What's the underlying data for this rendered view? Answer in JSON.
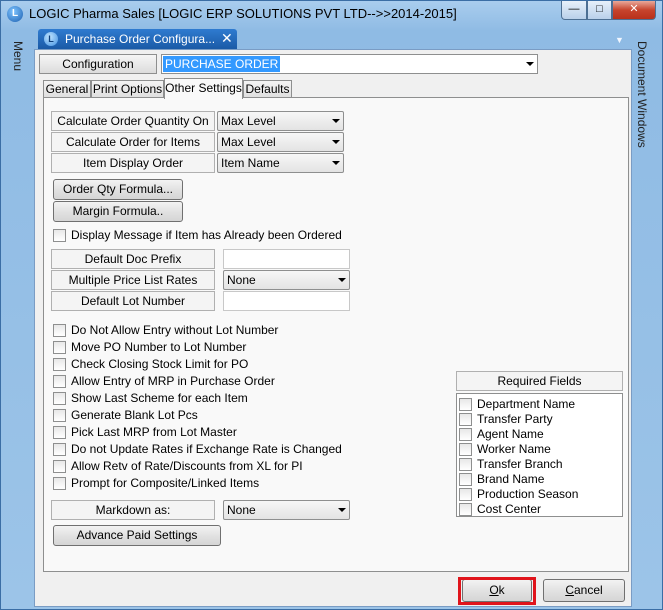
{
  "window": {
    "title": "LOGIC Pharma Sales  [LOGIC ERP SOLUTIONS PVT LTD-->>2014-2015]",
    "app_icon_glyph": "L",
    "min_glyph": "—",
    "max_glyph": "□",
    "close_glyph": "✕"
  },
  "left_rail": {
    "label": "Menu"
  },
  "right_rail": {
    "label": "Document Windows"
  },
  "doc_tab": {
    "label": "Purchase Order Configura...",
    "icon_glyph": "L",
    "close_glyph": "✕",
    "strip_arrow": "▼"
  },
  "config": {
    "label": "Configuration",
    "value": "PURCHASE ORDER"
  },
  "tabs": [
    {
      "label": "General"
    },
    {
      "label": "Print Options"
    },
    {
      "label": "Other Settings"
    },
    {
      "label": "Defaults"
    }
  ],
  "settings": {
    "calc_qty_label": "Calculate Order Quantity On",
    "calc_qty_value": "Max Level",
    "calc_items_label": "Calculate Order for Items",
    "calc_items_value": "Max Level",
    "item_display_label": "Item Display Order",
    "item_display_value": "Item Name",
    "order_qty_formula": "Order Qty Formula...",
    "margin_formula": "Margin Formula..",
    "display_msg": "Display Message if Item has Already been Ordered",
    "default_doc_prefix_label": "Default Doc Prefix",
    "default_doc_prefix_value": "",
    "multi_price_label": "Multiple Price List Rates",
    "multi_price_value": "None",
    "default_lot_label": "Default Lot Number",
    "default_lot_value": "",
    "options": [
      "Do Not Allow Entry without Lot Number",
      "Move PO Number to Lot Number",
      "Check Closing Stock Limit for PO",
      "Allow Entry of MRP in Purchase Order",
      "Show Last Scheme for each Item",
      "Generate Blank Lot Pcs",
      "Pick Last MRP from Lot Master",
      "Do not Update Rates if Exchange Rate is Changed",
      "Allow Retv of Rate/Discounts from XL for PI",
      "Prompt for Composite/Linked Items"
    ],
    "markdown_label": "Markdown as:",
    "markdown_value": "None",
    "advance_paid": "Advance Paid Settings"
  },
  "required_fields": {
    "title": "Required Fields",
    "items": [
      "Department Name",
      "Transfer Party",
      "Agent Name",
      "Worker Name",
      "Transfer Branch",
      "Brand Name",
      "Production Season",
      "Cost Center"
    ]
  },
  "footer": {
    "ok_first": "O",
    "ok_rest": "k",
    "cancel_first": "C",
    "cancel_rest": "ancel"
  },
  "colors": {
    "selection": "#3399ff",
    "highlight_border": "#e0141b",
    "tab_active_blue": "#1a5aa6"
  }
}
